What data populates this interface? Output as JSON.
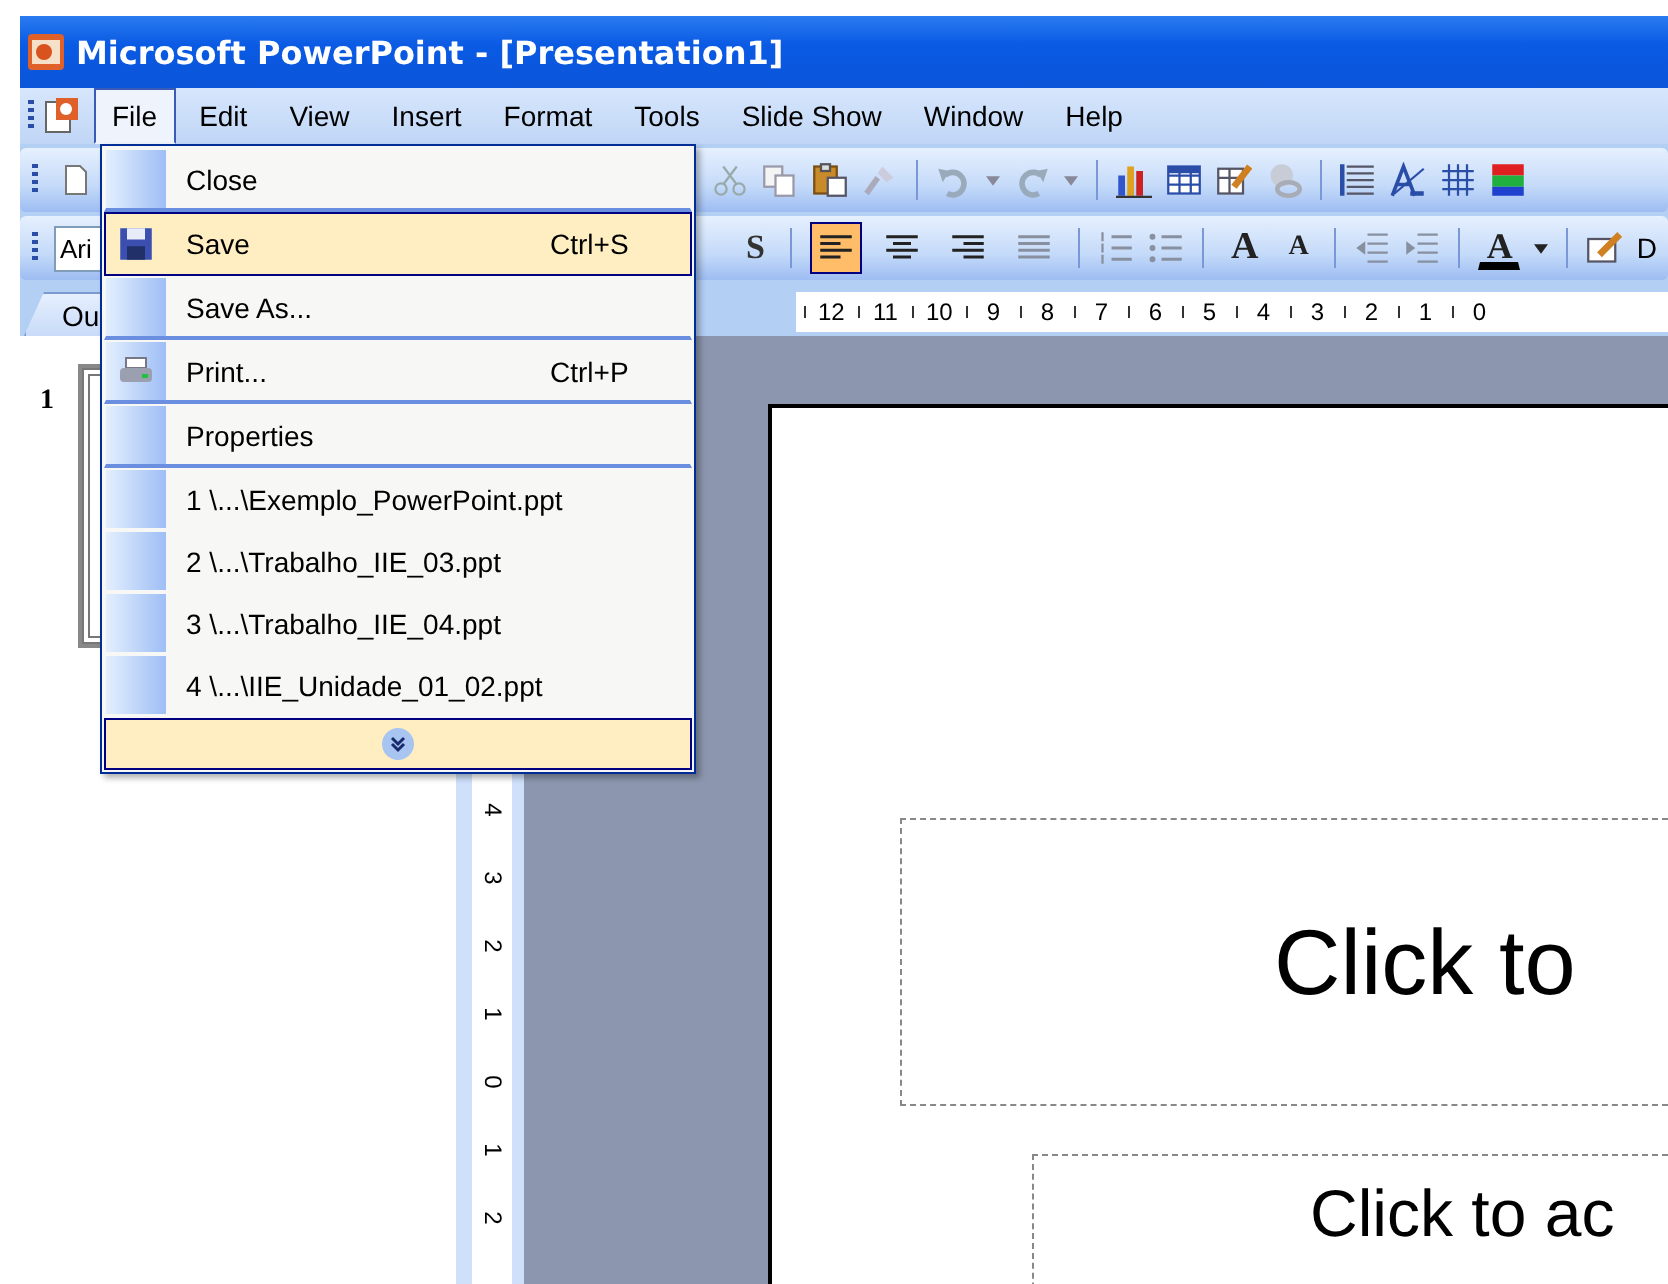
{
  "window": {
    "title": "Microsoft PowerPoint - [Presentation1]"
  },
  "menu_bar": [
    {
      "label": "File",
      "selected": true
    },
    {
      "label": "Edit",
      "selected": false
    },
    {
      "label": "View",
      "selected": false
    },
    {
      "label": "Insert",
      "selected": false
    },
    {
      "label": "Format",
      "selected": false
    },
    {
      "label": "Tools",
      "selected": false
    },
    {
      "label": "Slide Show",
      "selected": false
    },
    {
      "label": "Window",
      "selected": false
    },
    {
      "label": "Help",
      "selected": false
    }
  ],
  "formatting_toolbar": {
    "font": "Ari",
    "shadow": "S",
    "alignments": [
      {
        "selected": true
      },
      {
        "selected": false
      },
      {
        "selected": false
      },
      {
        "selected": false
      }
    ],
    "grow_font": "A",
    "shrink_font": "A",
    "font_color": "A",
    "design": "D"
  },
  "pane_tabs": [
    {
      "label": "Ou",
      "selected": false
    }
  ],
  "horizontal_ruler": [
    "12",
    "11",
    "10",
    "9",
    "8",
    "7",
    "6",
    "5",
    "4",
    "3",
    "2",
    "1",
    "0"
  ],
  "vertical_ruler": [
    "4",
    "3",
    "2",
    "1",
    "0",
    "1",
    "2"
  ],
  "slides_pane": {
    "slide_number": "1"
  },
  "slide": {
    "title_placeholder": "Click to",
    "subtitle_placeholder": "Click to ac"
  },
  "file_menu": [
    {
      "kind": "command",
      "label": "Close",
      "selected": false,
      "divider_below": true
    },
    {
      "kind": "save",
      "label": "Save",
      "shortcut": "Ctrl+S",
      "selected": true,
      "divider_below": false
    },
    {
      "kind": "command",
      "label": "Save As...",
      "selected": false,
      "divider_below": true
    },
    {
      "kind": "print",
      "label": "Print...",
      "shortcut": "Ctrl+P",
      "selected": false,
      "divider_below": true
    },
    {
      "kind": "command",
      "label": "Properties",
      "selected": false,
      "divider_below": true
    },
    {
      "kind": "recent",
      "label": "1 \\...\\Exemplo_PowerPoint.ppt",
      "selected": false,
      "divider_below": false
    },
    {
      "kind": "recent",
      "label": "2 \\...\\Trabalho_IIE_03.ppt",
      "selected": false,
      "divider_below": false
    },
    {
      "kind": "recent",
      "label": "3 \\...\\Trabalho_IIE_04.ppt",
      "selected": false,
      "divider_below": false
    },
    {
      "kind": "recent",
      "label": "4 \\...\\IIE_Unidade_01_02.ppt",
      "selected": false,
      "divider_below": false
    },
    {
      "kind": "expand",
      "selected": true
    }
  ]
}
